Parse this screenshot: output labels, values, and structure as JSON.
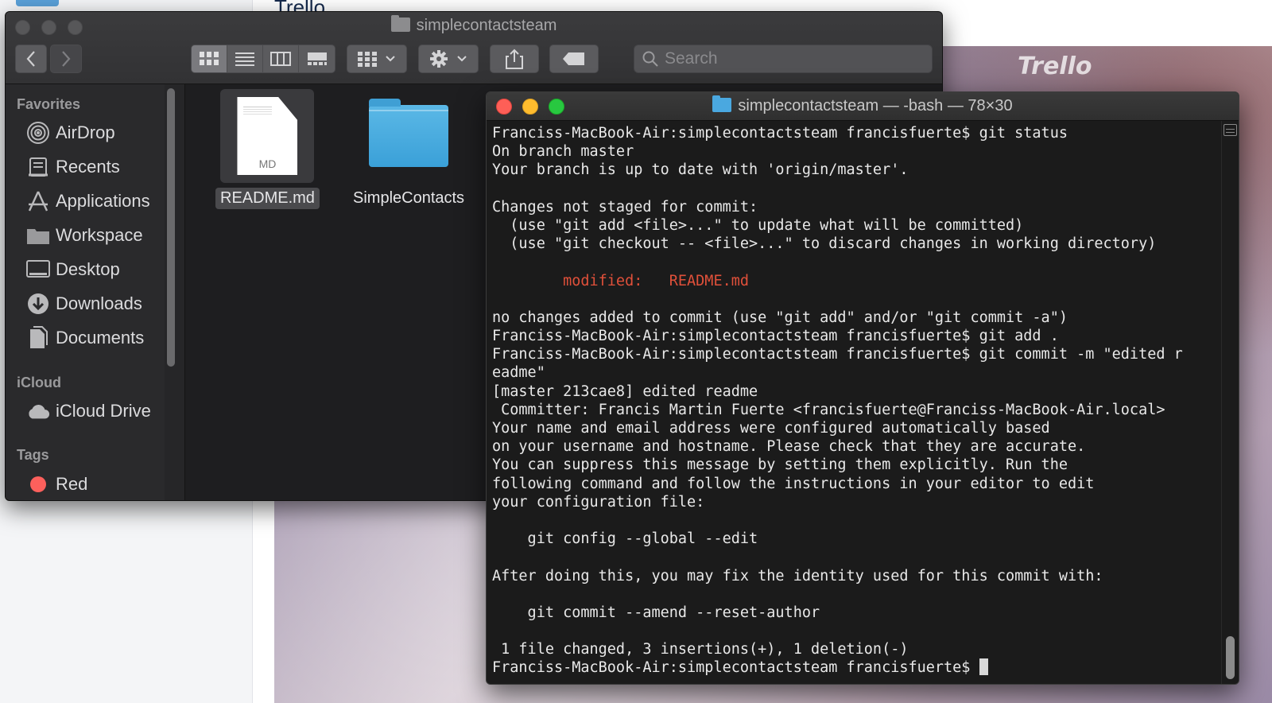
{
  "background": {
    "page_title": "Trello",
    "logo_text": "Trello"
  },
  "finder": {
    "title": "simplecontactsteam",
    "search_placeholder": "Search",
    "sidebar": {
      "favorites_label": "Favorites",
      "favorites": [
        {
          "label": "AirDrop",
          "icon": "airdrop-icon"
        },
        {
          "label": "Recents",
          "icon": "recents-icon"
        },
        {
          "label": "Applications",
          "icon": "applications-icon"
        },
        {
          "label": "Workspace",
          "icon": "folder-icon"
        },
        {
          "label": "Desktop",
          "icon": "desktop-icon"
        },
        {
          "label": "Downloads",
          "icon": "downloads-icon"
        },
        {
          "label": "Documents",
          "icon": "documents-icon"
        }
      ],
      "icloud_label": "iCloud",
      "icloud": [
        {
          "label": "iCloud Drive",
          "icon": "cloud-icon"
        }
      ],
      "tags_label": "Tags",
      "tags": [
        {
          "label": "Red",
          "color": "#fc605c"
        }
      ]
    },
    "files": [
      {
        "name": "README.md",
        "badge": "MD",
        "selected": true
      },
      {
        "name": "SimpleContacts",
        "selected": false
      }
    ]
  },
  "terminal": {
    "title": "simplecontactsteam — -bash — 78×30",
    "lines": [
      "Franciss-MacBook-Air:simplecontactsteam francisfuerte$ git status",
      "On branch master",
      "Your branch is up to date with 'origin/master'.",
      "",
      "Changes not staged for commit:",
      "  (use \"git add <file>...\" to update what will be committed)",
      "  (use \"git checkout -- <file>...\" to discard changes in working directory)",
      "",
      "        modified:   README.md",
      "",
      "no changes added to commit (use \"git add\" and/or \"git commit -a\")",
      "Franciss-MacBook-Air:simplecontactsteam francisfuerte$ git add .",
      "Franciss-MacBook-Air:simplecontactsteam francisfuerte$ git commit -m \"edited r",
      "eadme\"",
      "[master 213cae8] edited readme",
      " Committer: Francis Martin Fuerte <francisfuerte@Franciss-MacBook-Air.local>",
      "Your name and email address were configured automatically based",
      "on your username and hostname. Please check that they are accurate.",
      "You can suppress this message by setting them explicitly. Run the",
      "following command and follow the instructions in your editor to edit",
      "your configuration file:",
      "",
      "    git config --global --edit",
      "",
      "After doing this, you may fix the identity used for this commit with:",
      "",
      "    git commit --amend --reset-author",
      "",
      " 1 file changed, 3 insertions(+), 1 deletion(-)"
    ],
    "prompt": "Franciss-MacBook-Air:simplecontactsteam francisfuerte$ ",
    "colors": {
      "modified": "#e0503a",
      "text": "#e8e8e8",
      "background": "#1b1b1b"
    }
  }
}
